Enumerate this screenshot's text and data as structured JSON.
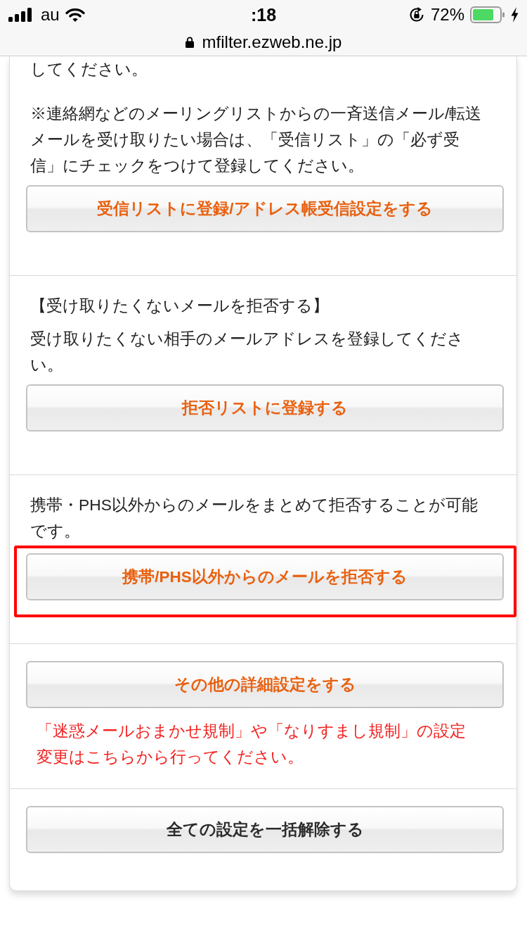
{
  "status_bar": {
    "carrier": "au",
    "time": ":18",
    "battery_text": "72%",
    "url": "mfilter.ezweb.ne.jp"
  },
  "sections": [
    {
      "blocks": [
        {
          "kind": "text",
          "text": "してください。"
        },
        {
          "kind": "text",
          "text": "※連絡網などのメーリングリストからの一斉送信メール/転送メールを受け取りたい場合は、「受信リスト」の「必ず受信」にチェックをつけて登録してください。"
        },
        {
          "kind": "button",
          "label": "受信リストに登録/アドレス帳受信設定をする",
          "highlighted": false
        }
      ]
    },
    {
      "blocks": [
        {
          "kind": "heading",
          "text": "【受け取りたくないメールを拒否する】"
        },
        {
          "kind": "text",
          "text": "受け取りたくない相手のメールアドレスを登録してください。"
        },
        {
          "kind": "button",
          "label": "拒否リストに登録する",
          "highlighted": false
        }
      ]
    },
    {
      "blocks": [
        {
          "kind": "text",
          "text": "携帯・PHS以外からのメールをまとめて拒否することが可能です。"
        },
        {
          "kind": "button",
          "label": "携帯/PHS以外からのメールを拒否する",
          "highlighted": true
        }
      ]
    },
    {
      "blocks": [
        {
          "kind": "button",
          "label": "その他の詳細設定をする",
          "highlighted": false
        },
        {
          "kind": "note",
          "text": "「迷惑メールおまかせ規制」や「なりすまし規制」の設定変更はこちらから行ってください。"
        }
      ]
    },
    {
      "blocks": [
        {
          "kind": "neutral_button",
          "label": "全ての設定を一括解除する",
          "highlighted": false
        }
      ]
    }
  ]
}
